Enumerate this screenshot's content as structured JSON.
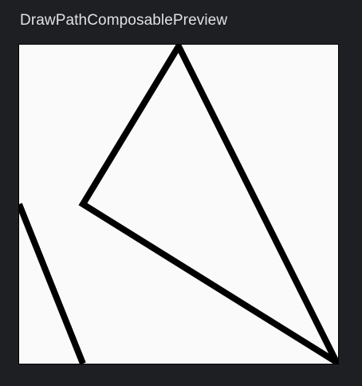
{
  "preview": {
    "title": "DrawPathComposablePreview"
  },
  "colors": {
    "ide_background": "#1e1f22",
    "title_text": "#dfe1e5",
    "canvas_background": "#fafafa",
    "path_stroke": "#000000",
    "frame_border": "#000000"
  }
}
